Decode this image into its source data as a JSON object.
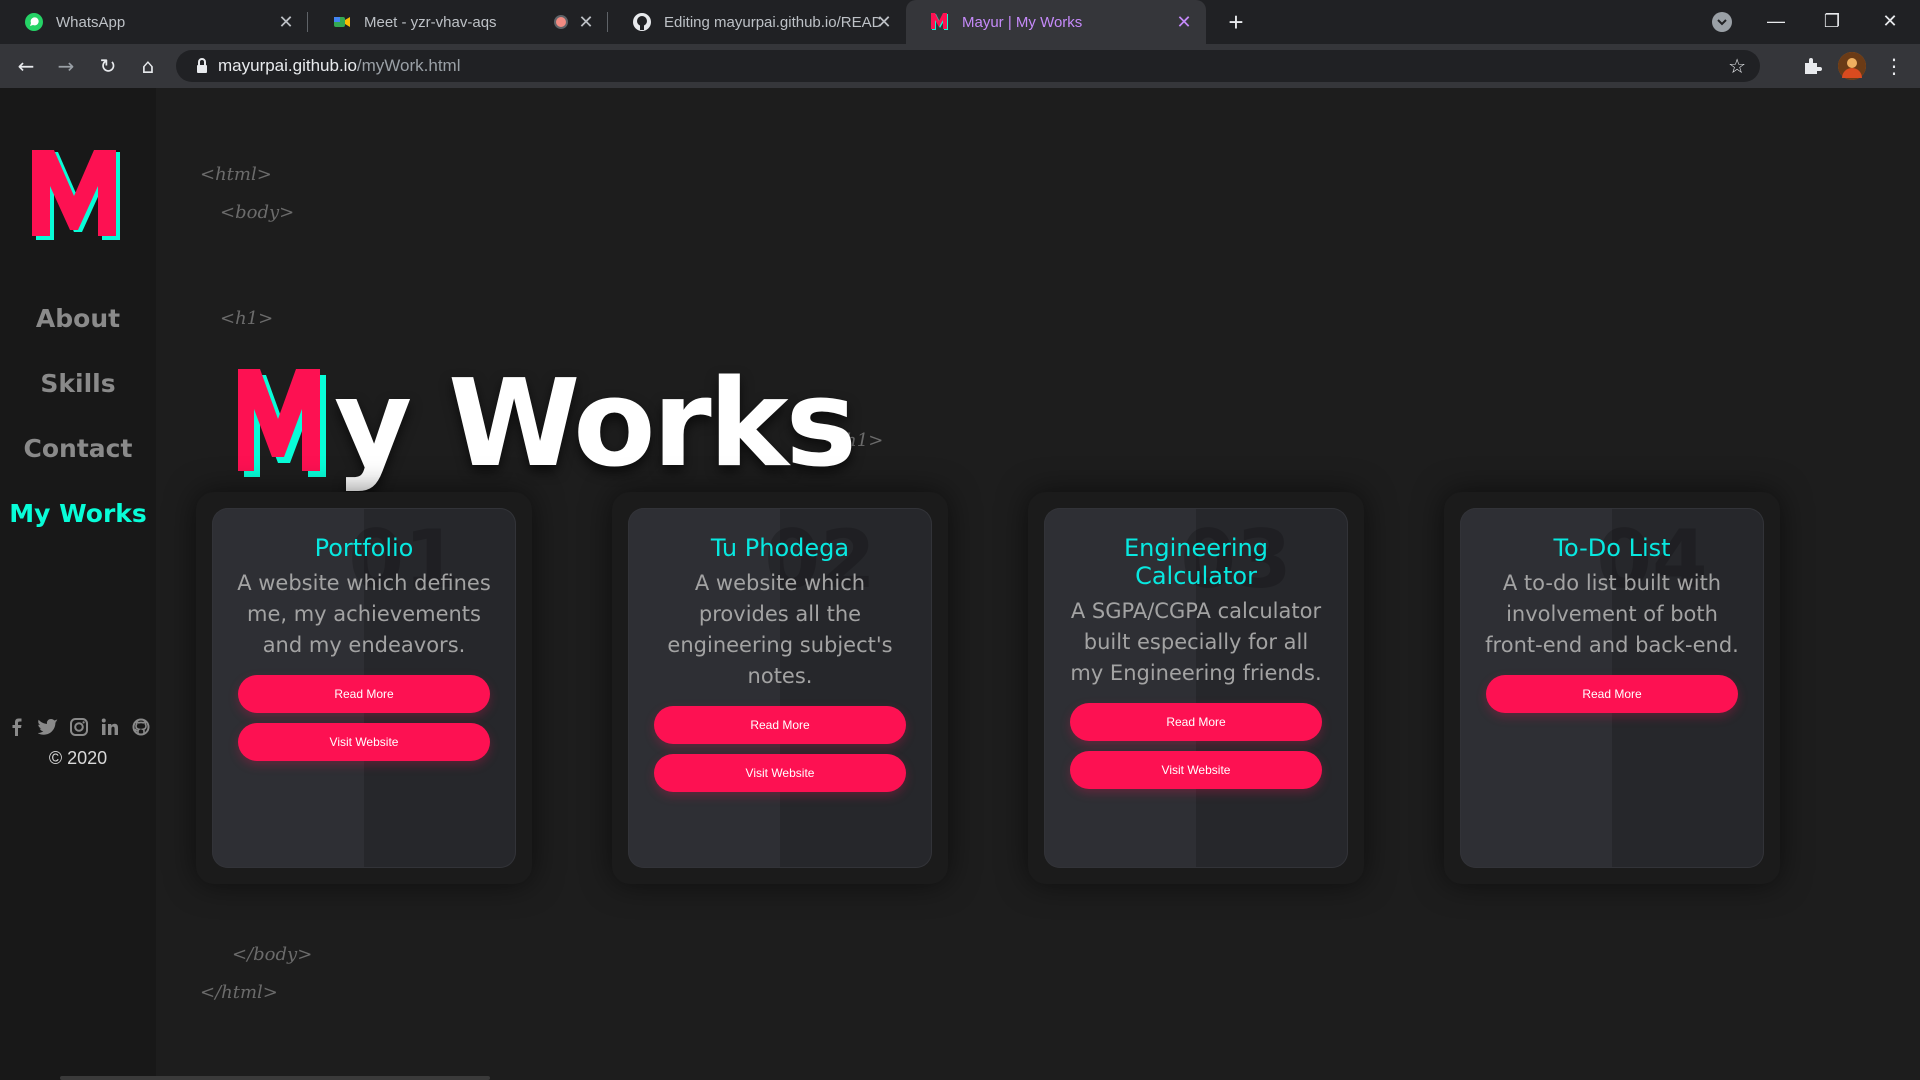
{
  "browser": {
    "tabs": [
      {
        "title": "WhatsApp",
        "icon": "whatsapp-icon"
      },
      {
        "title": "Meet - yzr-vhav-aqs",
        "icon": "google-meet-icon"
      },
      {
        "title": "Editing mayurpai.github.io/READ",
        "icon": "github-icon"
      },
      {
        "title": "Mayur | My Works",
        "icon": "m-logo-icon",
        "active": true
      }
    ],
    "new_tab": "+",
    "url_host": "mayurpai.github.io",
    "url_path": "/myWork.html"
  },
  "sidebar": {
    "logo_letter": "M",
    "nav": [
      {
        "label": "About"
      },
      {
        "label": "Skills"
      },
      {
        "label": "Contact"
      },
      {
        "label": "My Works",
        "active": true
      }
    ],
    "socials": [
      "facebook-icon",
      "twitter-icon",
      "instagram-icon",
      "linkedin-icon",
      "github-icon"
    ],
    "copyright": "© 2020"
  },
  "tags": {
    "html_open": "<html>",
    "body_open": "<body>",
    "h1_open": "<h1>",
    "h1_close": "</h1>",
    "body_close": "</body>",
    "html_close": "</html>"
  },
  "title": {
    "first_letter": "M",
    "rest": "y Works"
  },
  "cards": [
    {
      "number": "01",
      "title": "Portfolio",
      "description": "A website which defines me, my achievements and my endeavors.",
      "read_more": "Read More",
      "visit": "Visit Website"
    },
    {
      "number": "02",
      "title": "Tu Phodega",
      "description": "A website which provides all the engineering subject's notes.",
      "read_more": "Read More",
      "visit": "Visit Website"
    },
    {
      "number": "03",
      "title": "Engineering Calculator",
      "description": "A SGPA/CGPA calculator built especially for all my Engineering friends.",
      "read_more": "Read More",
      "visit": "Visit Website"
    },
    {
      "number": "04",
      "title": "To-Do List",
      "description": "A to-do list built with involvement of both front-end and back-end.",
      "read_more": "Read More"
    }
  ],
  "colors": {
    "accent_cyan": "#08fdd8",
    "accent_pink": "#fd1152",
    "background": "#1d1d1d",
    "sidebar": "#181818"
  }
}
